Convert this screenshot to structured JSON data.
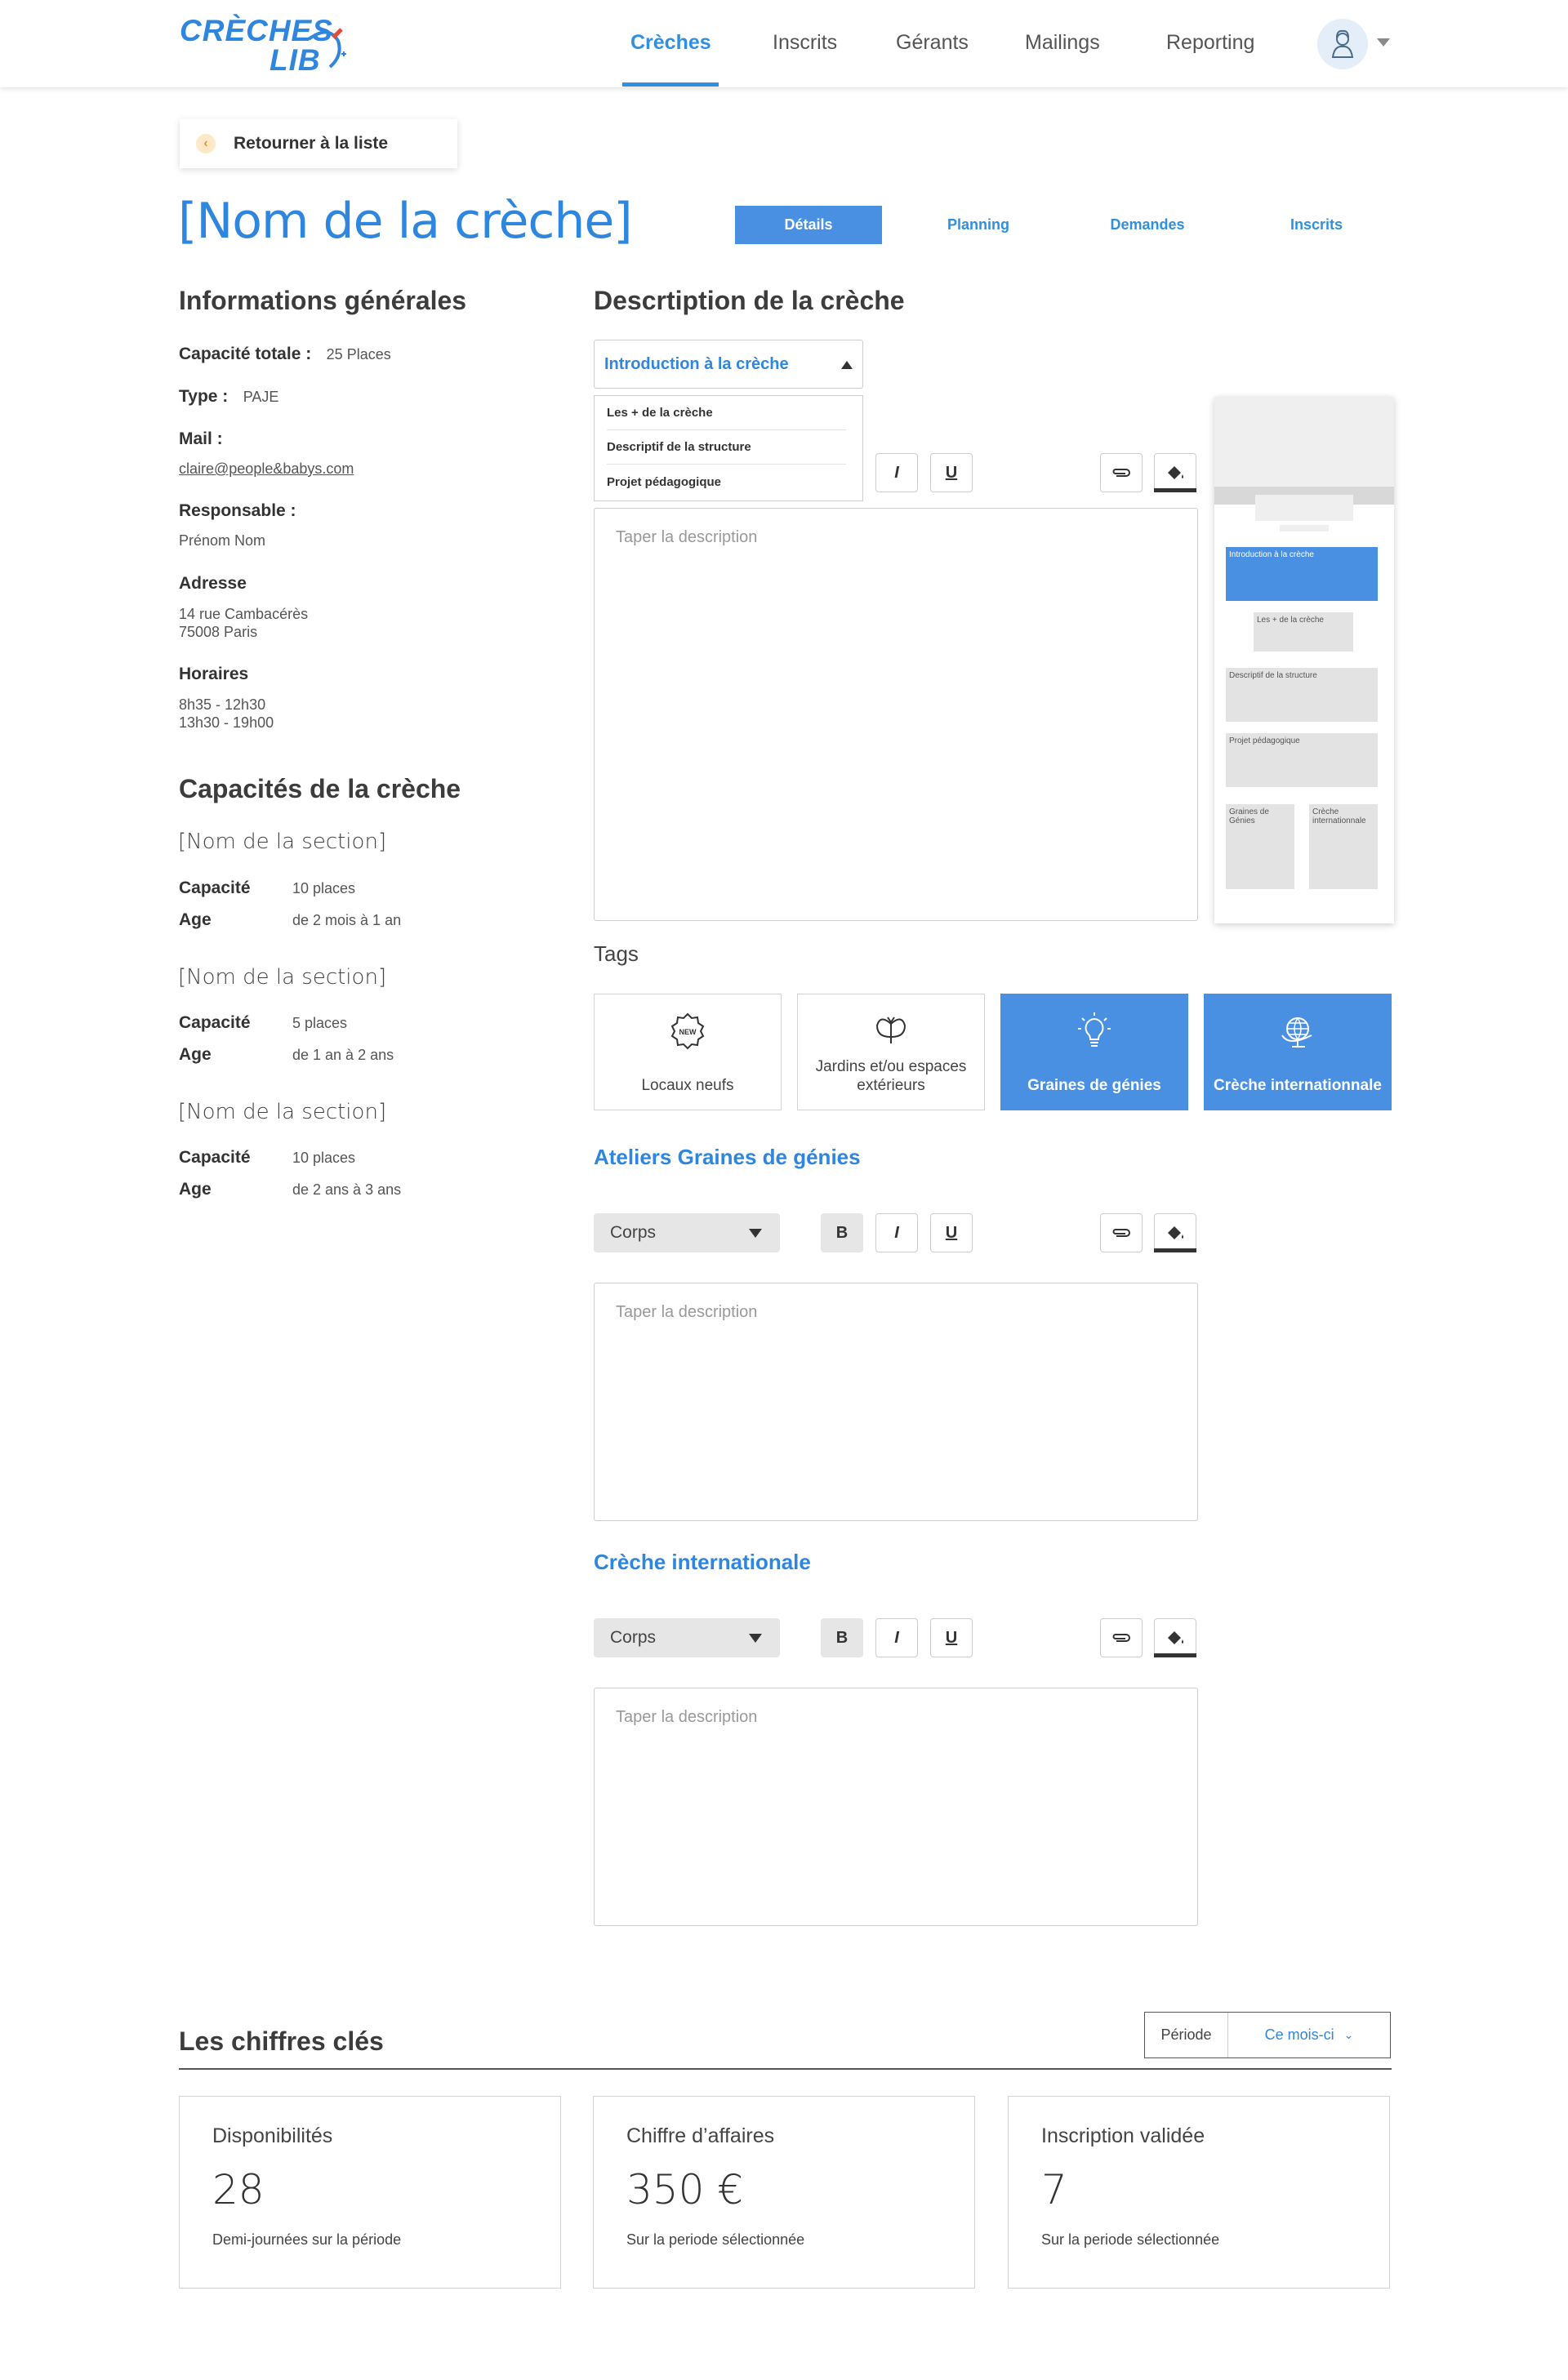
{
  "nav": {
    "logo_line1": "CRÈCHES",
    "logo_line2": "LIB",
    "items": [
      "Crèches",
      "Inscrits",
      "Gérants",
      "Mailings",
      "Reporting"
    ]
  },
  "back_label": "Retourner à la liste",
  "page_title": "[Nom de la crèche]",
  "tabs": [
    "Détails",
    "Planning",
    "Demandes",
    "Inscrits"
  ],
  "general": {
    "heading": "Informations générales",
    "capacity_label": "Capacité totale :",
    "capacity_value": "25 Places",
    "type_label": "Type :",
    "type_value": "PAJE",
    "mail_label": "Mail :",
    "mail_value": "claire@people&babys.com",
    "manager_label": "Responsable :",
    "manager_value": "Prénom Nom",
    "address_label": "Adresse",
    "address_line1": "14 rue Cambacérès",
    "address_line2": "75008 Paris",
    "hours_label": "Horaires",
    "hours_line1": "8h35 - 12h30",
    "hours_line2": "13h30 - 19h00"
  },
  "capacities": {
    "heading": "Capacités de la crèche",
    "sections": [
      {
        "name": "[Nom de la section]",
        "capacity_label": "Capacité",
        "capacity": "10 places",
        "age_label": "Age",
        "age": "de 2 mois à 1 an"
      },
      {
        "name": "[Nom de la section]",
        "capacity_label": "Capacité",
        "capacity": "5 places",
        "age_label": "Age",
        "age": "de 1 an à 2 ans"
      },
      {
        "name": "[Nom de la section]",
        "capacity_label": "Capacité",
        "capacity": "10 places",
        "age_label": "Age",
        "age": "de 2 ans à 3 ans"
      }
    ]
  },
  "description": {
    "heading": "Descrtiption de la crèche",
    "dropdown_value": "Introduction à la crèche",
    "dropdown_options": [
      "Les + de la crèche",
      "Descriptif de la structure",
      "Projet pédagogique"
    ],
    "placeholder": "Taper la description",
    "toolbar": {
      "italic": "I",
      "underline": "U",
      "bold": "B"
    }
  },
  "preview": {
    "intro": "Introduction à la crèche",
    "plus": "Les + de la crèche",
    "desc": "Descriptif de la structure",
    "projet": "Projet pédagogique",
    "graines": "Graines de Génies",
    "inter": "Crèche internationnale"
  },
  "tags": {
    "heading": "Tags",
    "items": [
      {
        "label": "Locaux neufs",
        "icon": "new-badge-icon",
        "selected": false
      },
      {
        "label": "Jardins et/ou espaces extérieurs",
        "icon": "butterfly-icon",
        "selected": false
      },
      {
        "label": "Graines de génies",
        "icon": "lightbulb-icon",
        "selected": true
      },
      {
        "label": "Crèche internationnale",
        "icon": "globe-icon",
        "selected": true
      }
    ]
  },
  "ateliers": {
    "heading": "Ateliers Graines de génies",
    "style": "Corps",
    "placeholder": "Taper la description"
  },
  "international": {
    "heading": "Crèche internationale",
    "style": "Corps",
    "placeholder": "Taper la description"
  },
  "keyfigures": {
    "heading": "Les chiffres clés",
    "period_label": "Période",
    "period_value": "Ce mois-ci",
    "cards": [
      {
        "title": "Disponibilités",
        "value": "28",
        "sub": "Demi-journées sur la période"
      },
      {
        "title": "Chiffre d’affaires",
        "value": "350 €",
        "sub": "Sur la periode sélectionnée"
      },
      {
        "title": "Inscription validée",
        "value": "7",
        "sub": "Sur la periode sélectionnée"
      }
    ]
  },
  "colors": {
    "primary": "#2e86de",
    "tab_active": "#4a90e2"
  }
}
